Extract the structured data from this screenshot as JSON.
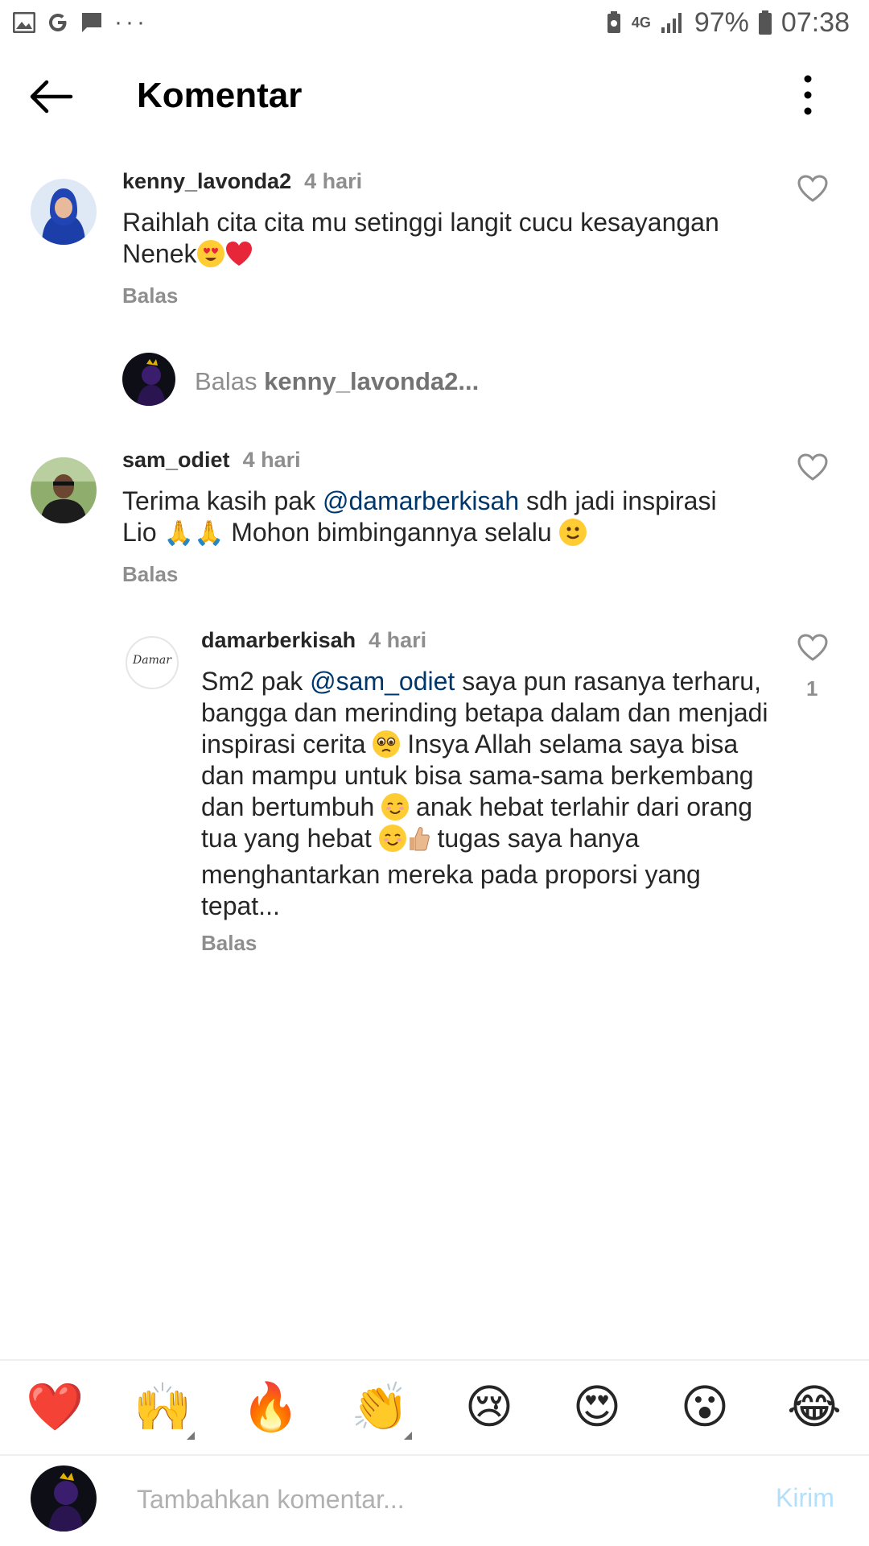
{
  "status_bar": {
    "battery_percent": "97%",
    "time": "07:38",
    "network": "4G",
    "more_dots": "···"
  },
  "header": {
    "title": "Komentar"
  },
  "comments": [
    {
      "username": "kenny_lavonda2",
      "time": "4 hari",
      "text_before": "Raihlah cita cita mu setinggi langit cucu kesayangan Nenek",
      "reply_label": "Balas"
    },
    {
      "username": "sam_odiet",
      "time": "4 hari",
      "text_part1": "Terima kasih pak ",
      "mention": "@damarberkisah",
      "text_part2": " sdh jadi inspirasi Lio ",
      "text_part3": " Mohon bimbingannya selalu ",
      "reply_label": "Balas"
    }
  ],
  "reply_prompt": {
    "prefix": "Balas ",
    "target": "kenny_lavonda2..."
  },
  "reply": {
    "username": "damarberkisah",
    "time": "4 hari",
    "text_part1": "Sm2 pak ",
    "mention": "@sam_odiet",
    "text_part2": " saya pun rasanya terharu, bangga dan merinding betapa dalam dan menjadi inspirasi cerita ",
    "text_part3": " Insya Allah selama saya bisa dan mampu untuk bisa sama-sama berkembang dan bertumbuh ",
    "text_part4": " anak hebat terlahir dari orang tua yang hebat ",
    "text_part5": " tugas saya hanya menghantarkan mereka pada proporsi yang tepat...",
    "like_count": "1",
    "reply_label": "Balas",
    "avatar_text": "Damar"
  },
  "reactions": [
    "❤️",
    "🙌",
    "🔥",
    "👏",
    "😢",
    "😍",
    "😮",
    "😂"
  ],
  "composer": {
    "placeholder": "Tambahkan komentar...",
    "send_label": "Kirim"
  },
  "colors": {
    "mention": "#00376b",
    "muted": "#8e8e8e",
    "send_disabled": "#b2dffc"
  }
}
